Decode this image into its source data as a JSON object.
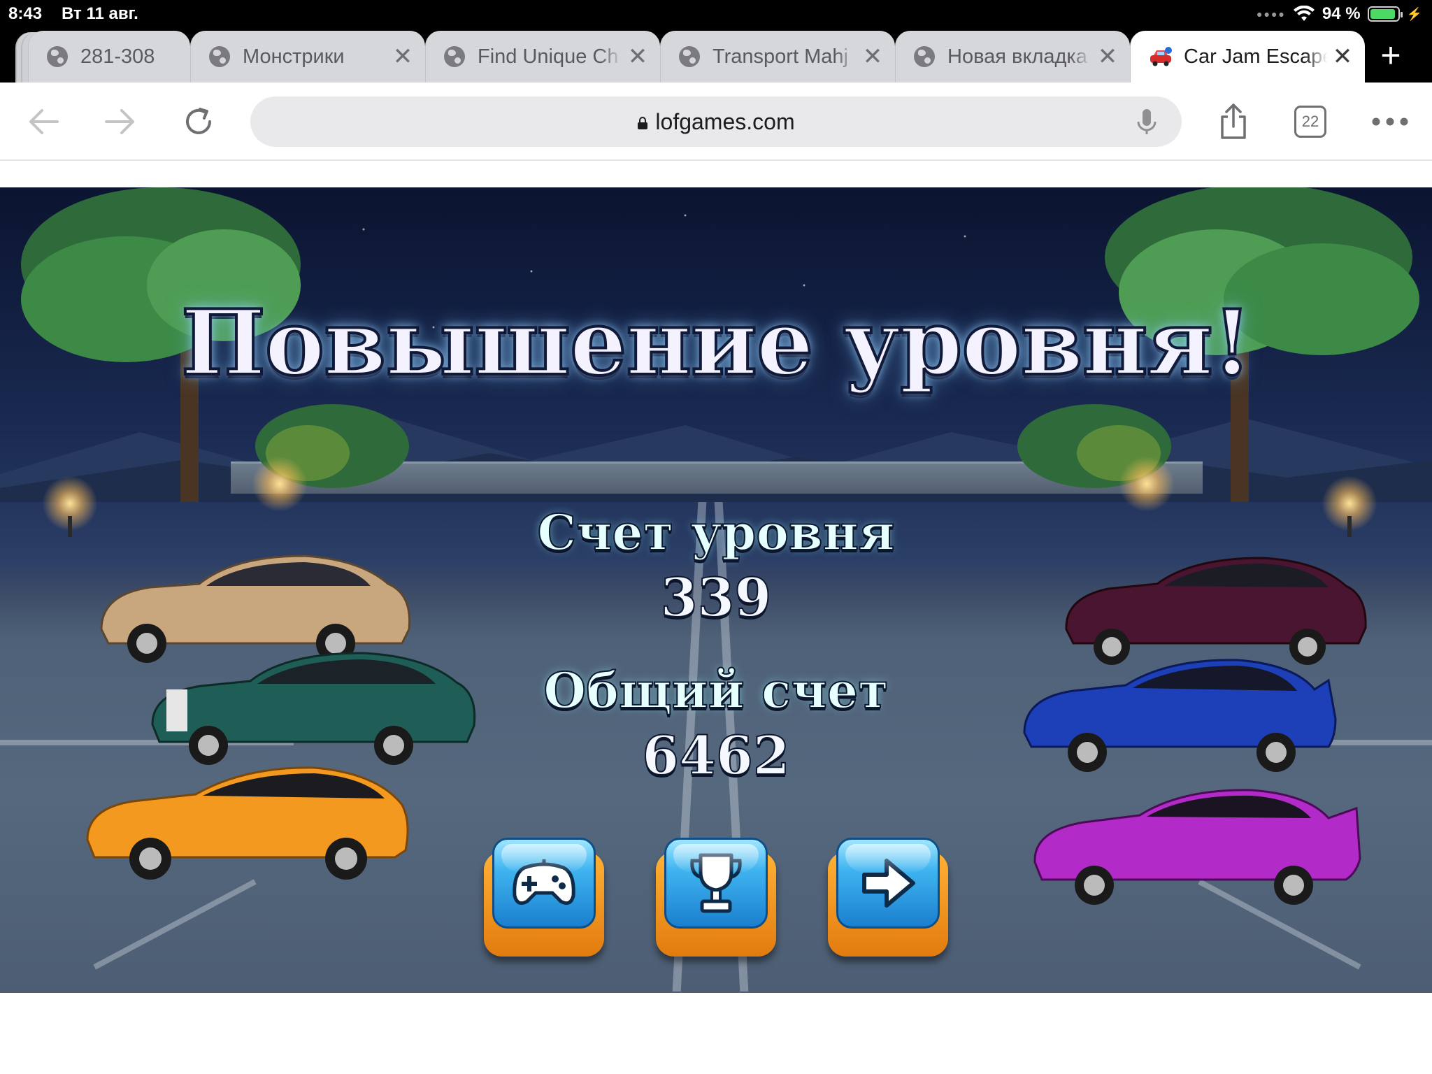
{
  "status_bar": {
    "time": "8:43",
    "date": "Вт 11 авг.",
    "battery": "94 %",
    "battery_level": 0.94
  },
  "tabs": [
    {
      "title": "281-308",
      "icon": "globe-icon",
      "active": false,
      "closable": false
    },
    {
      "title": "Монстрики",
      "icon": "globe-icon",
      "active": false,
      "closable": true
    },
    {
      "title": "Find Unique Ch",
      "icon": "globe-icon",
      "active": false,
      "closable": true
    },
    {
      "title": "Transport Mahj",
      "icon": "globe-icon",
      "active": false,
      "closable": true
    },
    {
      "title": "Новая вкладка",
      "icon": "globe-icon",
      "active": false,
      "closable": true
    },
    {
      "title": "Car Jam Escape",
      "icon": "car-icon",
      "active": true,
      "closable": true
    }
  ],
  "toolbar": {
    "url": "lofgames.com",
    "tab_count": "22"
  },
  "game": {
    "title": "Повышение уровня!",
    "level_score_label": "Счет уровня",
    "level_score": "339",
    "total_score_label": "Общий счет",
    "total_score": "6462",
    "buttons": [
      {
        "name": "gamepad-icon"
      },
      {
        "name": "trophy-icon"
      },
      {
        "name": "arrow-right-icon"
      }
    ],
    "car_colors": [
      "#c9a77e",
      "#1f5e57",
      "#f3991f",
      "#4a1530",
      "#1d3fb8",
      "#b22ac7"
    ]
  }
}
